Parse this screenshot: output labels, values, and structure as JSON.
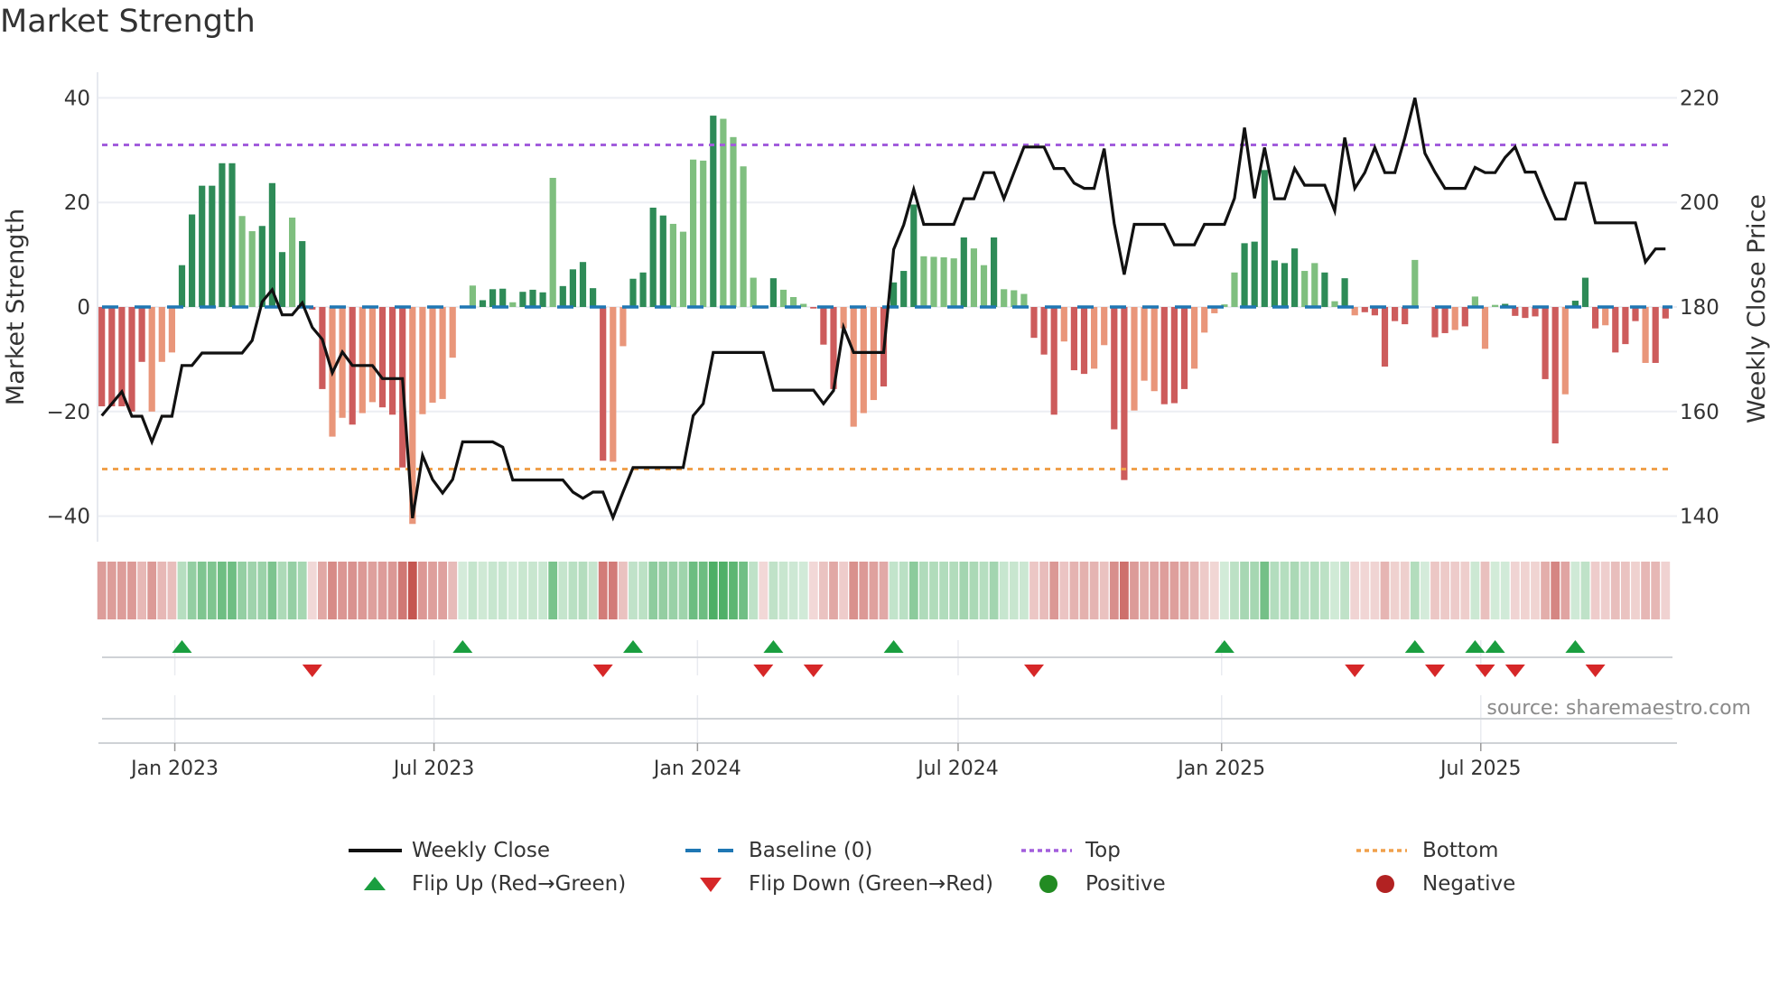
{
  "title": "Market Strength",
  "source": "source: sharemaestro.com",
  "colors": {
    "bar_pos_dark": "#2e8b57",
    "bar_pos_light": "#7fbf7f",
    "bar_neg_dark": "#cd5c5c",
    "bar_neg_light": "#e9967a",
    "baseline": "#1f77b4",
    "top": "#a25ddc",
    "bottom": "#f0a04b",
    "close": "#111111",
    "flip_up": "#1a9e3f",
    "flip_down": "#d62728",
    "positive": "#228b22",
    "negative": "#b22222",
    "heat_pos": "#3aa655",
    "heat_neg": "#c4544f"
  },
  "legend": {
    "weekly_close": "Weekly Close",
    "baseline": "Baseline (0)",
    "top": "Top",
    "bottom": "Bottom",
    "flip_up": "Flip Up (Red→Green)",
    "flip_down": "Flip Down (Green→Red)",
    "positive": "Positive",
    "negative": "Negative"
  },
  "chart_data": {
    "type": "bar+line",
    "title": "Market Strength",
    "ylabel": "Market Strength",
    "ylabel_right": "Weekly Close Price",
    "ylim": [
      -45,
      45
    ],
    "ylim_right": [
      135,
      225
    ],
    "y_ticks": [
      "40",
      "20",
      "0",
      "−20",
      "−40"
    ],
    "y_tick_values": [
      40,
      20,
      0,
      -20,
      -40
    ],
    "y_right_ticks": [
      "220",
      "200",
      "180",
      "160",
      "140"
    ],
    "y_right_tick_values": [
      220,
      200,
      180,
      160,
      140
    ],
    "x_ticks": [
      "Jan 2023",
      "Jul 2023",
      "Jan 2024",
      "Jul 2024",
      "Jan 2025",
      "Jul 2025"
    ],
    "x_tick_dates": [
      "2023-01-01",
      "2023-07-01",
      "2024-01-01",
      "2024-07-01",
      "2025-01-01",
      "2025-07-01"
    ],
    "start_date": "2022-11-11",
    "interval_days": 7,
    "top_level": 31,
    "bottom_level": -31,
    "baseline": 0,
    "grid": true,
    "legend_position": "bottom",
    "strength": [
      -19,
      -19,
      -19,
      -20,
      -10.5,
      -20,
      -10.5,
      -8.7,
      8,
      17.7,
      23.2,
      23.2,
      27.5,
      27.5,
      17.4,
      14.5,
      15.5,
      23.7,
      10.5,
      17.1,
      12.6,
      -0.5,
      -15.7,
      -24.8,
      -21.2,
      -22.5,
      -20.3,
      -18.2,
      -19.2,
      -20.6,
      -30.7,
      -41.5,
      -20.5,
      -18.3,
      -17.6,
      -9.7,
      0,
      4.1,
      1.3,
      3.4,
      3.5,
      0.9,
      2.9,
      3.3,
      2.8,
      24.7,
      4,
      7.2,
      8.6,
      3.6,
      -29.4,
      -29.6,
      -7.5,
      5.4,
      6.6,
      19,
      17.5,
      15.9,
      14.4,
      28.2,
      28,
      36.6,
      36,
      32.5,
      26.9,
      5.6,
      -0.3,
      5.5,
      3.3,
      1.9,
      0.6,
      -0.3,
      -7.2,
      -15.7,
      -4.1,
      -22.9,
      -20.3,
      -17.8,
      -15.2,
      4.7,
      6.9,
      19.6,
      9.7,
      9.6,
      9.5,
      9.3,
      13.3,
      11.2,
      8,
      13.3,
      3.4,
      3.2,
      2.5,
      -5.9,
      -9.1,
      -20.6,
      -6.6,
      -12.1,
      -12.8,
      -11.8,
      -7.3,
      -23.4,
      -33.1,
      -19.8,
      -14.1,
      -16.1,
      -18.6,
      -18.4,
      -15.7,
      -11.8,
      -4.9,
      -1.2,
      0.5,
      6.6,
      12.2,
      12.5,
      26.2,
      8.9,
      8.4,
      11.2,
      6.9,
      8.4,
      6.6,
      1.1,
      5.5,
      -1.6,
      -1,
      -1.6,
      -11.4,
      -2.7,
      -3.3,
      9,
      0,
      -5.8,
      -5,
      -4.4,
      -3.7,
      2,
      -8,
      0.4,
      0.6,
      -1.7,
      -2.1,
      -1.8,
      -13.8,
      -26.1,
      -16.7,
      1.2,
      5.6,
      -4.1,
      -3.5,
      -8.7,
      -7.1,
      -2.7,
      -10.7,
      -10.7,
      -2.2
    ],
    "shade": "dddddlllddddddlldddldddlldlldddllllldldddldddldddddllddddlllldllllldllldddllllddddlllldlldllldddlddllddllldddlllllddddddlldldldddddldddldlllddddddldddldddlddldlldll",
    "weekly_close": [
      159.2,
      161.5,
      163.8,
      159.1,
      159.1,
      154.2,
      159.1,
      159.1,
      168.8,
      168.8,
      171.2,
      171.2,
      171.2,
      171.2,
      171.2,
      173.6,
      181,
      183.3,
      178.5,
      178.5,
      180.8,
      176.1,
      173.8,
      167.4,
      171.4,
      168.8,
      168.8,
      168.8,
      166.3,
      166.3,
      166.3,
      139.6,
      151.6,
      147,
      144.4,
      147,
      154.2,
      154.2,
      154.2,
      154.2,
      153.2,
      146.9,
      146.9,
      146.9,
      146.9,
      146.9,
      146.9,
      144.6,
      143.4,
      144.6,
      144.6,
      139.7,
      144.6,
      149.3,
      149.3,
      149.3,
      149.3,
      149.3,
      149.3,
      159.2,
      161.5,
      171.3,
      171.3,
      171.3,
      171.3,
      171.3,
      171.3,
      164.1,
      164.1,
      164.1,
      164.1,
      164.1,
      161.5,
      164,
      176.1,
      171.3,
      171.3,
      171.3,
      171.3,
      191,
      195.7,
      202.5,
      195.8,
      195.8,
      195.8,
      195.8,
      200.7,
      200.7,
      205.7,
      205.7,
      200.7,
      205.7,
      210.6,
      210.6,
      210.6,
      206.5,
      206.5,
      203.7,
      202.7,
      202.7,
      210.3,
      196,
      186.2,
      195.8,
      195.8,
      195.8,
      195.8,
      191.9,
      191.9,
      191.9,
      195.8,
      195.8,
      195.8,
      200.8,
      214.3,
      200.8,
      210.5,
      200.7,
      200.7,
      206.5,
      203.3,
      203.3,
      203.3,
      198.4,
      212.4,
      202.7,
      205.7,
      210.5,
      205.7,
      205.7,
      212.4,
      220,
      209.4,
      205.8,
      202.7,
      202.7,
      202.7,
      206.7,
      205.7,
      205.7,
      208.6,
      210.6,
      205.8,
      205.8,
      201.1,
      196.8,
      196.8,
      203.7,
      203.7,
      196.1,
      196.1,
      196.1,
      196.1,
      196.1,
      188.6,
      191.1,
      191.1
    ],
    "flip_up_weeks": [
      8,
      36,
      53,
      67,
      79,
      112,
      131,
      137,
      139,
      147
    ],
    "flip_down_weeks": [
      21,
      50,
      66,
      71,
      93,
      125,
      133,
      138,
      141,
      149
    ]
  }
}
